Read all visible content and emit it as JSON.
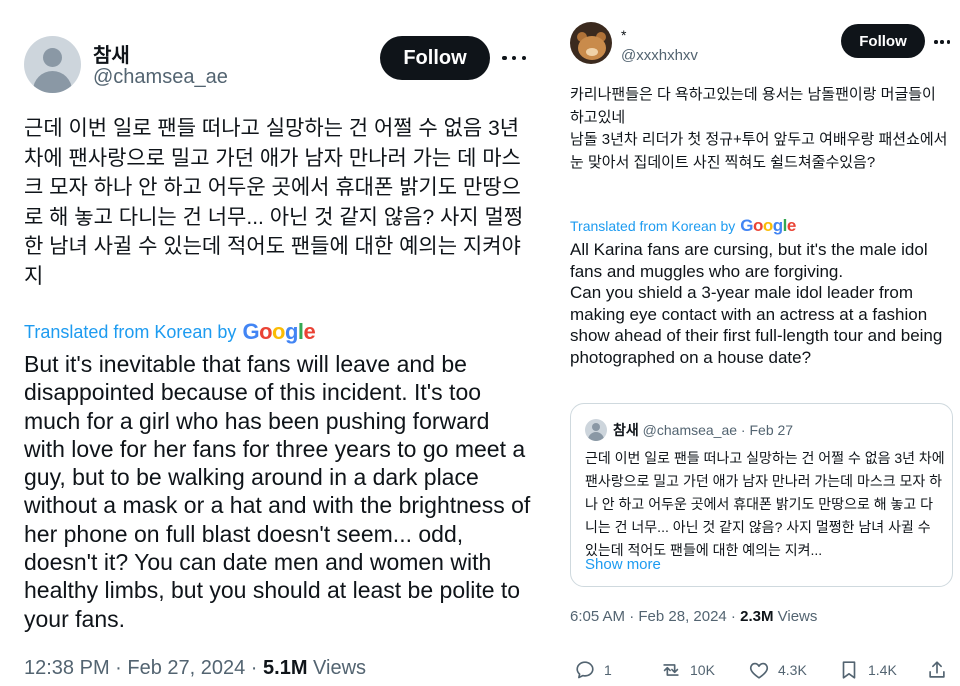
{
  "left_tweet": {
    "author_name": "참새",
    "author_handle": "@chamsea_ae",
    "follow_label": "Follow",
    "korean_text": "근데 이번 일로 팬들 떠나고 실망하는 건 어쩔 수 없음 3년 차에 팬사랑으로 밀고 가던 애가 남자 만나러 가는 데 마스크 모자 하나 안 하고 어두운 곳에서 휴대폰 밝기도 만땅으로 해 놓고 다니는 건 너무... 아닌 것 같지 않음? 사지 멀쩡한 남녀 사귈 수 있는데 적어도 팬들에 대한 예의는 지켜야지",
    "translated_label": "Translated from Korean by",
    "google_letters": [
      "G",
      "o",
      "o",
      "g",
      "l",
      "e"
    ],
    "english_text": "But it's inevitable that fans will leave and be disappointed because of this incident. It's too much for a girl who has been pushing forward with love for her fans for three years to go meet a guy, but to be walking around in a dark place without a mask or a hat and with the brightness of her phone on full blast doesn't seem... odd, doesn't it? You can date men and women with healthy limbs, but you should at least be polite to your fans.",
    "time": "12:38 PM · Feb 27, 2024 · ",
    "views_count": "5.1M",
    "views_label": " Views"
  },
  "right_tweet": {
    "author_name": "*",
    "author_handle": "@xxxhxhxv",
    "follow_label": "Follow",
    "korean_text": "카리나팬들은 다 욕하고있는데 용서는 남돌팬이랑 머글들이 하고있네\n남돌 3년차 리더가 첫 정규+투어 앞두고 여배우랑 패션쇼에서 눈 맞아서 집데이트 사진 찍혀도 쉴드쳐줄수있음?",
    "translated_label": "Translated from Korean by",
    "google_letters": [
      "G",
      "o",
      "o",
      "g",
      "l",
      "e"
    ],
    "english_text": "All Karina fans are cursing, but it's the male idol fans and muggles who are forgiving.\nCan you shield a 3-year male idol leader from making eye contact with an actress at a fashion show ahead of their first full-length tour and being photographed on a house date?",
    "quote": {
      "author_name": "참새",
      "author_handle": "@chamsea_ae · Feb 27",
      "text": "근데 이번 일로 팬들 떠나고 실망하는 건 어쩔 수 없음 3년 차에 팬사랑으로 밀고 가던 애가 남자 만나러 가는데 마스크 모자 하나 안 하고 어두운 곳에서 휴대폰 밝기도 만땅으로 해 놓고 다니는 건 너무... 아닌 것 같지 않음? 사지 멀쩡한 남녀 사귈 수 있는데 적어도 팬들에 대한 예의는 지켜...",
      "show_more": "Show more"
    },
    "time": "6:05 AM · Feb 28, 2024 · ",
    "views_count": "2.3M",
    "views_label": " Views",
    "actions": {
      "reply_count": "1",
      "repost_count": "10K",
      "like_count": "4.3K",
      "bookmark_count": "1.4K"
    }
  },
  "colors": {
    "link_blue": "#1d9bf0",
    "text_primary": "#0f1419",
    "text_secondary": "#536471",
    "button_bg": "#0f1419",
    "border": "#cfd9de"
  },
  "icons": {
    "reply": "reply-icon",
    "repost": "repost-icon",
    "like": "heart-icon",
    "bookmark": "bookmark-icon",
    "share": "share-icon",
    "more": "more-icon"
  }
}
